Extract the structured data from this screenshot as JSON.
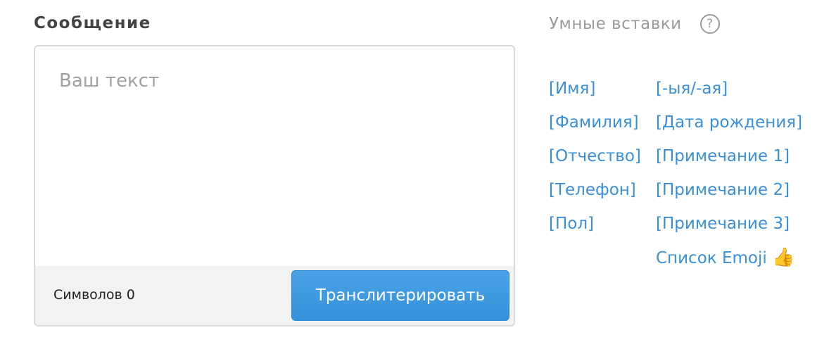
{
  "message": {
    "title": "Сообщение",
    "placeholder": "Ваш текст",
    "value": "",
    "counter_label": "Символов",
    "counter_value": "0",
    "button_label": "Транслитерировать"
  },
  "smart_inserts": {
    "title": "Умные вставки",
    "help_glyph": "?",
    "left": [
      "[Имя]",
      "[Фамилия]",
      "[Отчество]",
      "[Телефон]",
      "[Пол]"
    ],
    "right": [
      "[-ыя/-ая]",
      "[Дата рождения]",
      "[Примечание 1]",
      "[Примечание 2]",
      "[Примечание 3]"
    ],
    "emoji_link": "Список Emoji",
    "emoji_icon": "👍",
    "emoji_icon_name": "thumbs-up-icon"
  },
  "colors": {
    "link": "#3a8fd6",
    "button": "#3d97de",
    "muted": "#9b9b9b"
  }
}
